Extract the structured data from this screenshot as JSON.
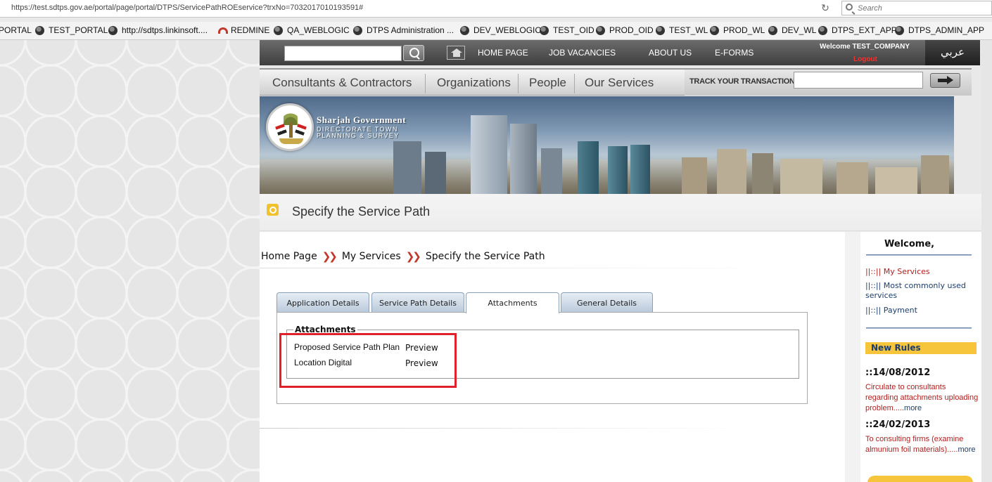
{
  "browser": {
    "url": "https://test.sdtps.gov.ae/portal/page/portal/DTPS/ServicePathROEservice?trxNo=7032017010193591#",
    "search_placeholder": "Search",
    "bookmarks": [
      "PORTAL",
      "TEST_PORTAL",
      "http://sdtps.linkinsoft....",
      "REDMINE",
      "QA_WEBLOGIC",
      "DTPS Administration ...",
      "DEV_WEBLOGIC",
      "TEST_OID",
      "PROD_OID",
      "TEST_WL",
      "PROD_WL",
      "DEV_WL",
      "DTPS_EXT_APP",
      "DTPS_ADMIN_APP"
    ]
  },
  "header": {
    "nav": [
      "HOME PAGE",
      "JOB VACANCIES",
      "ABOUT US",
      "E-FORMS"
    ],
    "welcome": "Welcome TEST_COMPANY",
    "logout": "Logout",
    "language": "عربي"
  },
  "main_nav": {
    "items": [
      "Consultants & Contractors",
      "Organizations",
      "People",
      "Our Services"
    ],
    "track_label": "TRACK YOUR TRANSACTION"
  },
  "banner": {
    "title": "Sharjah Government",
    "dept_line1": "DIRECTORATE TOWN",
    "dept_line2": "PLANNING & SURVEY"
  },
  "page": {
    "title": "Specify the Service Path",
    "breadcrumb": [
      "Home Page",
      "My Services",
      "Specify the Service Path"
    ]
  },
  "tabs": [
    {
      "label": "Application Details",
      "active": false
    },
    {
      "label": "Service Path Details",
      "active": false
    },
    {
      "label": "Attachments",
      "active": true
    },
    {
      "label": "General Details",
      "active": false
    }
  ],
  "attachments": {
    "legend": "Attachments",
    "rows": [
      {
        "name": "Proposed Service Path Plan",
        "action": "Preview"
      },
      {
        "name": "Location Digital",
        "action": "Preview"
      }
    ]
  },
  "sidebar": {
    "welcome": "Welcome,",
    "links": [
      "||::|| My Services",
      "||::|| Most commonly used services",
      "||::|| Payment"
    ],
    "new_rules_label": "New Rules",
    "rules": [
      {
        "date": "::14/08/2012",
        "text": "Circulate to consultants regarding attachments uploading problem.....",
        "more": "more"
      },
      {
        "date": "::24/02/2013",
        "text": "To consulting firms (examine almunium foil materials).....",
        "more": "more"
      }
    ]
  },
  "colors": {
    "accent_red": "#c0392b",
    "highlight_box": "#e0202a",
    "rules_bar": "#f6c53c",
    "link_blue": "#1d3d6d"
  }
}
